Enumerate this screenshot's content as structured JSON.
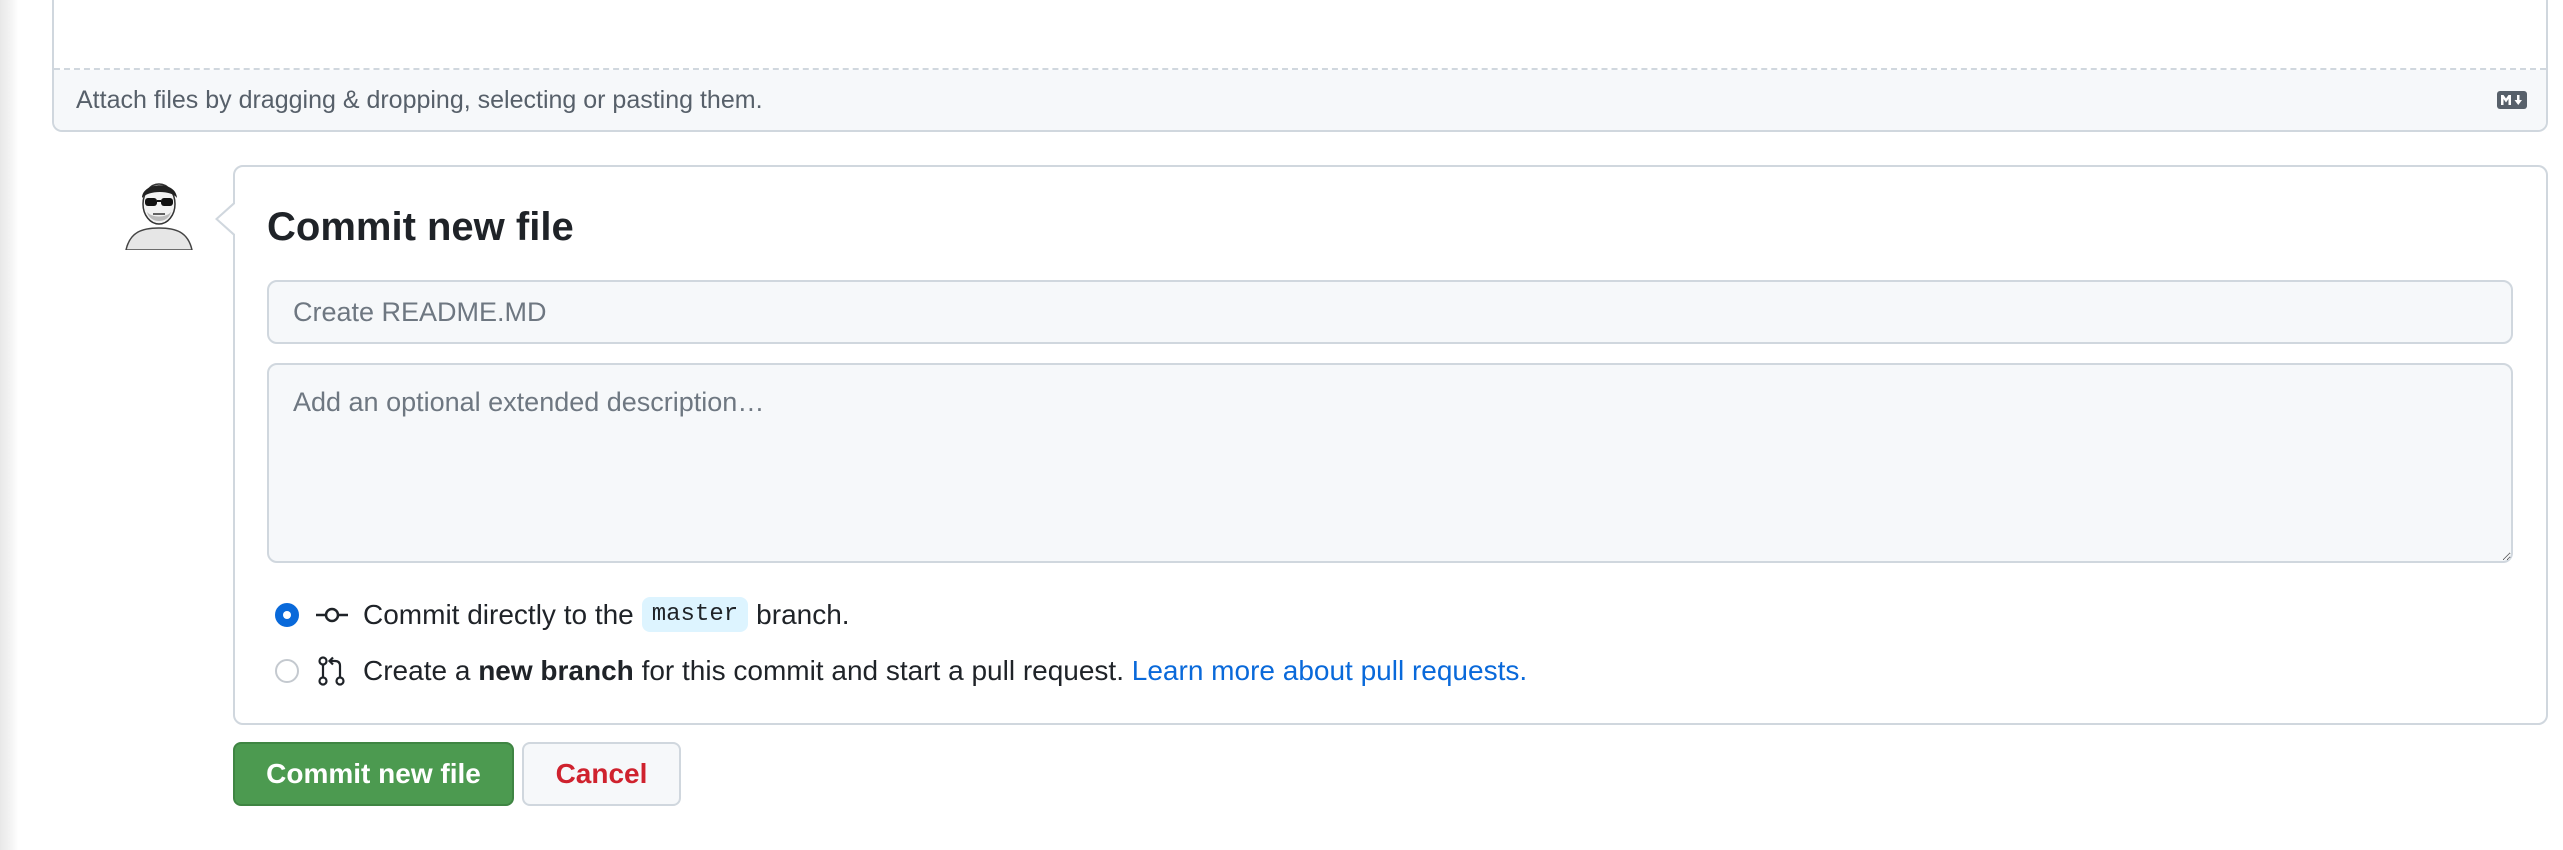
{
  "editor": {
    "attach_text": "Attach files by dragging & dropping, selecting or pasting them.",
    "markdown_icon": "markdown-icon"
  },
  "commit": {
    "title": "Commit new file",
    "summary_placeholder": "Create README.MD",
    "description_placeholder": "Add an optional extended description…",
    "option_direct": {
      "prefix": "Commit directly to the",
      "branch": "master",
      "suffix": "branch.",
      "selected": true,
      "icon": "git-commit-icon"
    },
    "option_new_branch": {
      "prefix": "Create a",
      "bold": "new branch",
      "suffix": "for this commit and start a pull request.",
      "link": "Learn more about pull requests.",
      "selected": false,
      "icon": "git-pull-request-icon"
    }
  },
  "buttons": {
    "commit_label": "Commit new file",
    "cancel_label": "Cancel"
  },
  "colors": {
    "primary_button": "#4c9a50",
    "danger_text": "#cf222e",
    "link": "#0969da",
    "radio_selected": "#0969da"
  }
}
